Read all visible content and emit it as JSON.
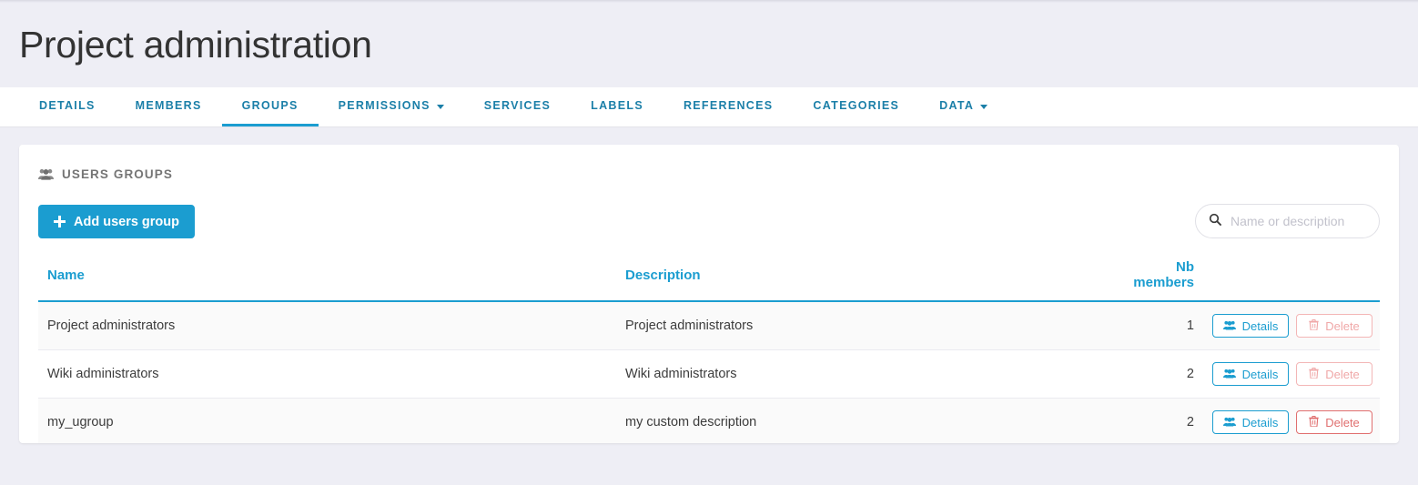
{
  "page": {
    "title": "Project administration",
    "accent_color": "#1b9dd0",
    "background_color": "#eeeef5",
    "danger_color": "#e06f6f"
  },
  "tabs": [
    {
      "label": "DETAILS",
      "active": false,
      "has_caret": false
    },
    {
      "label": "MEMBERS",
      "active": false,
      "has_caret": false
    },
    {
      "label": "GROUPS",
      "active": true,
      "has_caret": false
    },
    {
      "label": "PERMISSIONS",
      "active": false,
      "has_caret": true
    },
    {
      "label": "SERVICES",
      "active": false,
      "has_caret": false
    },
    {
      "label": "LABELS",
      "active": false,
      "has_caret": false
    },
    {
      "label": "REFERENCES",
      "active": false,
      "has_caret": false
    },
    {
      "label": "CATEGORIES",
      "active": false,
      "has_caret": false
    },
    {
      "label": "DATA",
      "active": false,
      "has_caret": true
    }
  ],
  "card": {
    "title": "USERS GROUPS",
    "title_icon": "users-icon"
  },
  "toolbar": {
    "add_label": "Add users group",
    "add_icon": "plus-icon",
    "search": {
      "placeholder": "Name or description",
      "value": "",
      "icon": "search-icon"
    }
  },
  "table": {
    "columns": [
      {
        "label": "Name"
      },
      {
        "label": "Description"
      },
      {
        "label": "Nb members"
      },
      {
        "label": ""
      }
    ],
    "rows": [
      {
        "name": "Project administrators",
        "description": "Project administrators",
        "nb_members": "1",
        "details_label": "Details",
        "delete_label": "Delete",
        "delete_enabled": false
      },
      {
        "name": "Wiki administrators",
        "description": "Wiki administrators",
        "nb_members": "2",
        "details_label": "Details",
        "delete_label": "Delete",
        "delete_enabled": false
      },
      {
        "name": "my_ugroup",
        "description": "my custom description",
        "nb_members": "2",
        "details_label": "Details",
        "delete_label": "Delete",
        "delete_enabled": true
      }
    ]
  }
}
